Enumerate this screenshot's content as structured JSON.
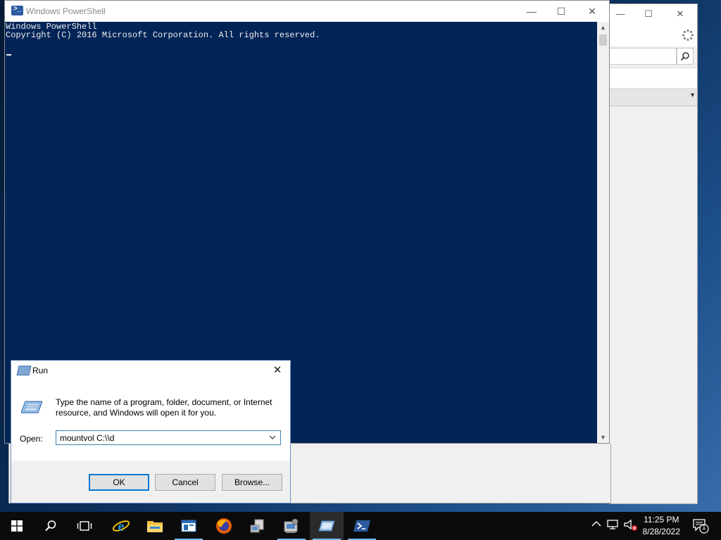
{
  "powershell": {
    "title": "Windows PowerShell",
    "lines": [
      "Windows PowerShell",
      "Copyright (C) 2016 Microsoft Corporation. All rights reserved."
    ],
    "minimize_glyph": "—",
    "maximize_glyph": "☐",
    "close_glyph": "✕",
    "bg_color": "#012456"
  },
  "background_window": {
    "minimize_glyph": "—",
    "maximize_glyph": "☐",
    "close_glyph": "✕",
    "search_icon": "search-icon",
    "settings_icon": "loading-icon"
  },
  "run_dialog": {
    "title": "Run",
    "message": "Type the name of a program, folder, document, or Internet resource, and Windows will open it for you.",
    "open_label": "Open:",
    "command_value": "mountvol C:\\\\d",
    "ok_label": "OK",
    "cancel_label": "Cancel",
    "browse_label": "Browse...",
    "close_glyph": "✕"
  },
  "taskbar": {
    "items": [
      {
        "name": "start-icon"
      },
      {
        "name": "search-icon"
      },
      {
        "name": "task-view-icon"
      },
      {
        "name": "internet-explorer-icon"
      },
      {
        "name": "file-explorer-icon"
      },
      {
        "name": "server-manager-icon"
      },
      {
        "name": "firefox-icon"
      },
      {
        "name": "network-app-icon"
      },
      {
        "name": "computer-management-icon"
      },
      {
        "name": "run-icon"
      },
      {
        "name": "powershell-icon"
      }
    ],
    "time": "11:25 PM",
    "date": "8/28/2022",
    "notification_count": "1",
    "accent_color": "#76b9ed"
  }
}
